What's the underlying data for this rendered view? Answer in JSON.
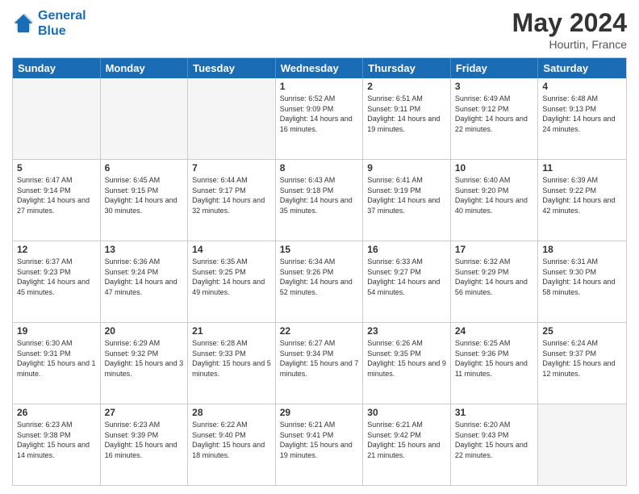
{
  "header": {
    "logo_line1": "General",
    "logo_line2": "Blue",
    "month_title": "May 2024",
    "location": "Hourtin, France"
  },
  "days_of_week": [
    "Sunday",
    "Monday",
    "Tuesday",
    "Wednesday",
    "Thursday",
    "Friday",
    "Saturday"
  ],
  "weeks": [
    [
      {
        "day": "",
        "sunrise": "",
        "sunset": "",
        "daylight": ""
      },
      {
        "day": "",
        "sunrise": "",
        "sunset": "",
        "daylight": ""
      },
      {
        "day": "",
        "sunrise": "",
        "sunset": "",
        "daylight": ""
      },
      {
        "day": "1",
        "sunrise": "Sunrise: 6:52 AM",
        "sunset": "Sunset: 9:09 PM",
        "daylight": "Daylight: 14 hours and 16 minutes."
      },
      {
        "day": "2",
        "sunrise": "Sunrise: 6:51 AM",
        "sunset": "Sunset: 9:11 PM",
        "daylight": "Daylight: 14 hours and 19 minutes."
      },
      {
        "day": "3",
        "sunrise": "Sunrise: 6:49 AM",
        "sunset": "Sunset: 9:12 PM",
        "daylight": "Daylight: 14 hours and 22 minutes."
      },
      {
        "day": "4",
        "sunrise": "Sunrise: 6:48 AM",
        "sunset": "Sunset: 9:13 PM",
        "daylight": "Daylight: 14 hours and 24 minutes."
      }
    ],
    [
      {
        "day": "5",
        "sunrise": "Sunrise: 6:47 AM",
        "sunset": "Sunset: 9:14 PM",
        "daylight": "Daylight: 14 hours and 27 minutes."
      },
      {
        "day": "6",
        "sunrise": "Sunrise: 6:45 AM",
        "sunset": "Sunset: 9:15 PM",
        "daylight": "Daylight: 14 hours and 30 minutes."
      },
      {
        "day": "7",
        "sunrise": "Sunrise: 6:44 AM",
        "sunset": "Sunset: 9:17 PM",
        "daylight": "Daylight: 14 hours and 32 minutes."
      },
      {
        "day": "8",
        "sunrise": "Sunrise: 6:43 AM",
        "sunset": "Sunset: 9:18 PM",
        "daylight": "Daylight: 14 hours and 35 minutes."
      },
      {
        "day": "9",
        "sunrise": "Sunrise: 6:41 AM",
        "sunset": "Sunset: 9:19 PM",
        "daylight": "Daylight: 14 hours and 37 minutes."
      },
      {
        "day": "10",
        "sunrise": "Sunrise: 6:40 AM",
        "sunset": "Sunset: 9:20 PM",
        "daylight": "Daylight: 14 hours and 40 minutes."
      },
      {
        "day": "11",
        "sunrise": "Sunrise: 6:39 AM",
        "sunset": "Sunset: 9:22 PM",
        "daylight": "Daylight: 14 hours and 42 minutes."
      }
    ],
    [
      {
        "day": "12",
        "sunrise": "Sunrise: 6:37 AM",
        "sunset": "Sunset: 9:23 PM",
        "daylight": "Daylight: 14 hours and 45 minutes."
      },
      {
        "day": "13",
        "sunrise": "Sunrise: 6:36 AM",
        "sunset": "Sunset: 9:24 PM",
        "daylight": "Daylight: 14 hours and 47 minutes."
      },
      {
        "day": "14",
        "sunrise": "Sunrise: 6:35 AM",
        "sunset": "Sunset: 9:25 PM",
        "daylight": "Daylight: 14 hours and 49 minutes."
      },
      {
        "day": "15",
        "sunrise": "Sunrise: 6:34 AM",
        "sunset": "Sunset: 9:26 PM",
        "daylight": "Daylight: 14 hours and 52 minutes."
      },
      {
        "day": "16",
        "sunrise": "Sunrise: 6:33 AM",
        "sunset": "Sunset: 9:27 PM",
        "daylight": "Daylight: 14 hours and 54 minutes."
      },
      {
        "day": "17",
        "sunrise": "Sunrise: 6:32 AM",
        "sunset": "Sunset: 9:29 PM",
        "daylight": "Daylight: 14 hours and 56 minutes."
      },
      {
        "day": "18",
        "sunrise": "Sunrise: 6:31 AM",
        "sunset": "Sunset: 9:30 PM",
        "daylight": "Daylight: 14 hours and 58 minutes."
      }
    ],
    [
      {
        "day": "19",
        "sunrise": "Sunrise: 6:30 AM",
        "sunset": "Sunset: 9:31 PM",
        "daylight": "Daylight: 15 hours and 1 minute."
      },
      {
        "day": "20",
        "sunrise": "Sunrise: 6:29 AM",
        "sunset": "Sunset: 9:32 PM",
        "daylight": "Daylight: 15 hours and 3 minutes."
      },
      {
        "day": "21",
        "sunrise": "Sunrise: 6:28 AM",
        "sunset": "Sunset: 9:33 PM",
        "daylight": "Daylight: 15 hours and 5 minutes."
      },
      {
        "day": "22",
        "sunrise": "Sunrise: 6:27 AM",
        "sunset": "Sunset: 9:34 PM",
        "daylight": "Daylight: 15 hours and 7 minutes."
      },
      {
        "day": "23",
        "sunrise": "Sunrise: 6:26 AM",
        "sunset": "Sunset: 9:35 PM",
        "daylight": "Daylight: 15 hours and 9 minutes."
      },
      {
        "day": "24",
        "sunrise": "Sunrise: 6:25 AM",
        "sunset": "Sunset: 9:36 PM",
        "daylight": "Daylight: 15 hours and 11 minutes."
      },
      {
        "day": "25",
        "sunrise": "Sunrise: 6:24 AM",
        "sunset": "Sunset: 9:37 PM",
        "daylight": "Daylight: 15 hours and 12 minutes."
      }
    ],
    [
      {
        "day": "26",
        "sunrise": "Sunrise: 6:23 AM",
        "sunset": "Sunset: 9:38 PM",
        "daylight": "Daylight: 15 hours and 14 minutes."
      },
      {
        "day": "27",
        "sunrise": "Sunrise: 6:23 AM",
        "sunset": "Sunset: 9:39 PM",
        "daylight": "Daylight: 15 hours and 16 minutes."
      },
      {
        "day": "28",
        "sunrise": "Sunrise: 6:22 AM",
        "sunset": "Sunset: 9:40 PM",
        "daylight": "Daylight: 15 hours and 18 minutes."
      },
      {
        "day": "29",
        "sunrise": "Sunrise: 6:21 AM",
        "sunset": "Sunset: 9:41 PM",
        "daylight": "Daylight: 15 hours and 19 minutes."
      },
      {
        "day": "30",
        "sunrise": "Sunrise: 6:21 AM",
        "sunset": "Sunset: 9:42 PM",
        "daylight": "Daylight: 15 hours and 21 minutes."
      },
      {
        "day": "31",
        "sunrise": "Sunrise: 6:20 AM",
        "sunset": "Sunset: 9:43 PM",
        "daylight": "Daylight: 15 hours and 22 minutes."
      },
      {
        "day": "",
        "sunrise": "",
        "sunset": "",
        "daylight": ""
      }
    ]
  ]
}
